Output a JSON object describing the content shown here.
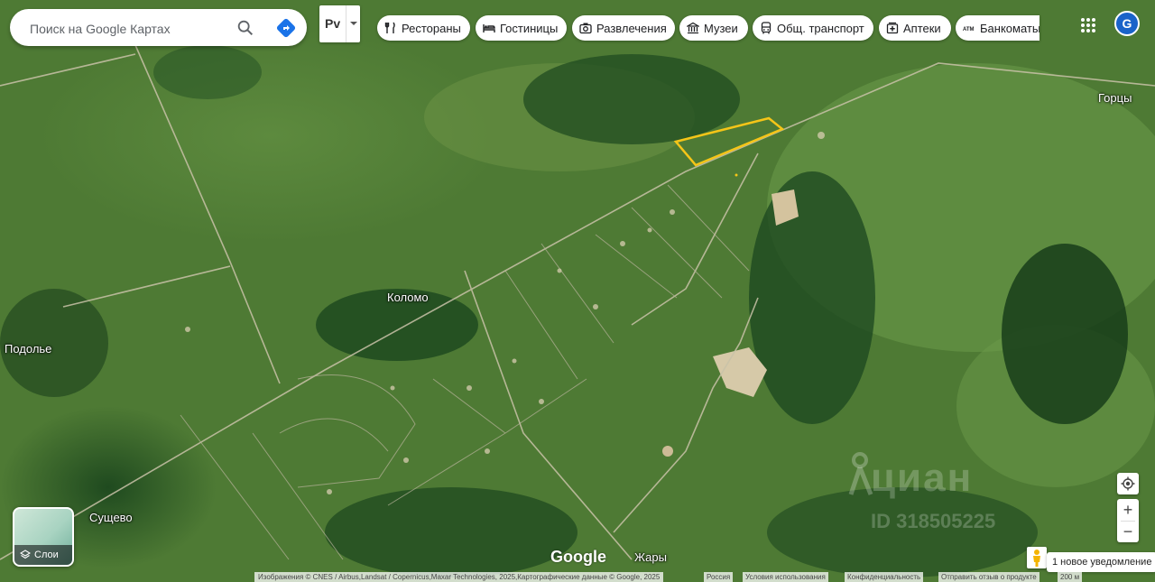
{
  "search": {
    "placeholder": "Поиск на Google Картах"
  },
  "mode_label": "Рv",
  "chips": [
    {
      "label": "Рестораны",
      "icon": "fork-knife-icon"
    },
    {
      "label": "Гостиницы",
      "icon": "bed-icon"
    },
    {
      "label": "Развлечения",
      "icon": "camera-icon"
    },
    {
      "label": "Музеи",
      "icon": "museum-icon"
    },
    {
      "label": "Общ. транспорт",
      "icon": "bus-icon"
    },
    {
      "label": "Аптеки",
      "icon": "pharmacy-icon"
    },
    {
      "label": "Банкоматы",
      "icon": "atm-icon"
    }
  ],
  "account_initial": "G",
  "places": {
    "gortsy": "Горцы",
    "kolomo": "Коломо",
    "podolye": "Подолье",
    "sushchevo": "Сущево",
    "zhary": "Жары"
  },
  "layers_label": "Слои",
  "watermark": {
    "brand": "циан",
    "id": "ID 318505225"
  },
  "google_logo": "Google",
  "attribution": "Изображения © CNES / Airbus,Landsat / Copernicus,Maxar Technologies, 2025,Картографические данные © Google, 2025",
  "footer_links": [
    "Россия",
    "Условия использования",
    "Конфиденциальность",
    "Отправить отзыв о продукте"
  ],
  "scale": "200 м",
  "notification": "1 новое уведомление",
  "colors": {
    "parcel_outline": "#f5c518",
    "accent_blue": "#1a73e8"
  }
}
